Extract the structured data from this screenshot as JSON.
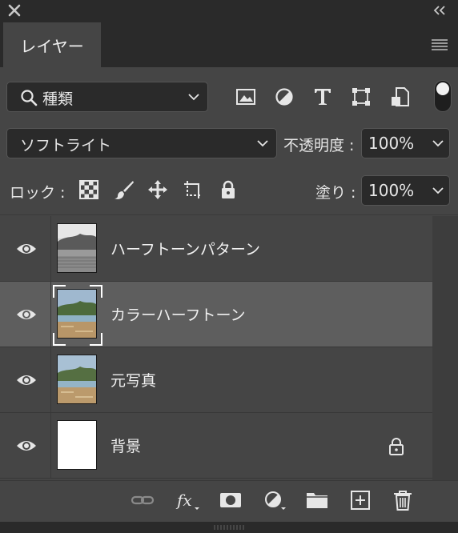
{
  "panel": {
    "tab_label": "レイヤー"
  },
  "filter": {
    "kind_label": "種類",
    "icons": [
      "image-filter-icon",
      "adjustment-filter-icon",
      "type-filter-icon",
      "shape-filter-icon",
      "smart-object-filter-icon"
    ]
  },
  "blend": {
    "mode": "ソフトライト",
    "opacity_label": "不透明度 :",
    "opacity_value": "100%"
  },
  "lock": {
    "label": "ロック :",
    "fill_label": "塗り :",
    "fill_value": "100%"
  },
  "layers": [
    {
      "name": "ハーフトーンパターン",
      "visible": true,
      "selected": false,
      "thumb": "bw-photo"
    },
    {
      "name": "カラーハーフトーン",
      "visible": true,
      "selected": true,
      "thumb": "color-photo"
    },
    {
      "name": "元写真",
      "visible": true,
      "selected": false,
      "thumb": "color-photo"
    },
    {
      "name": "背景",
      "visible": true,
      "selected": false,
      "thumb": "white",
      "locked": true
    }
  ],
  "bottom_icons": [
    "link-layers-icon",
    "fx-icon",
    "mask-icon",
    "adjustment-layer-icon",
    "group-folder-icon",
    "new-layer-icon",
    "trash-icon"
  ]
}
